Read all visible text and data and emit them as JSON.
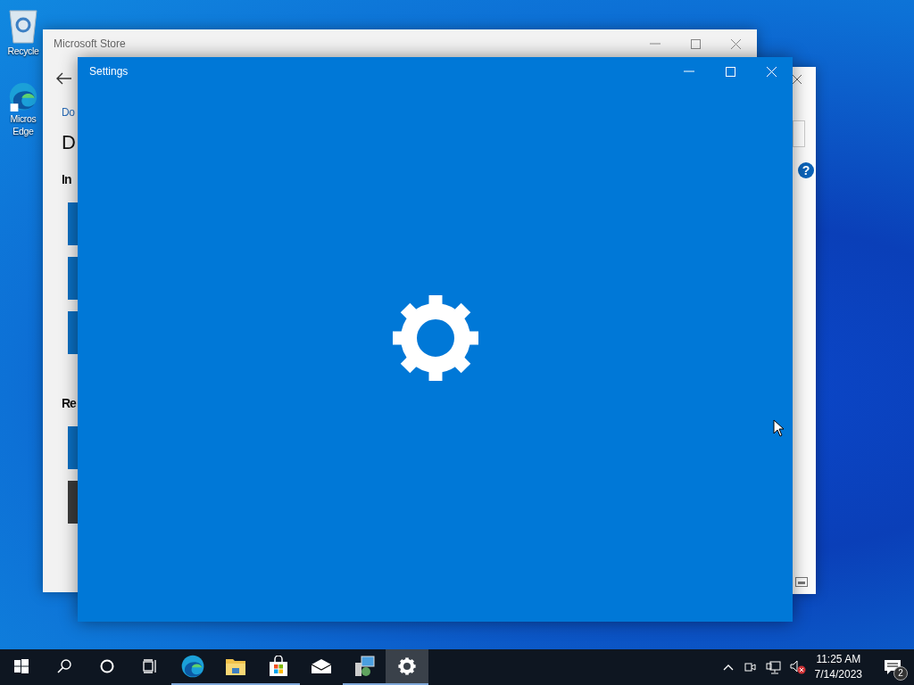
{
  "desktop_icons": [
    {
      "kind": "recycle-bin",
      "lines": [
        "Recycle"
      ]
    },
    {
      "kind": "edge",
      "lines": [
        "Micros",
        "Edge"
      ]
    }
  ],
  "store_window": {
    "title": "Microsoft Store",
    "breadcrumb": "Do",
    "heading": "D",
    "sections": [
      {
        "title": "In",
        "tiles": [
          {
            "color": "#0a6fc2"
          },
          {
            "color": "#0a6fc2"
          },
          {
            "color": "#0a6fc2"
          }
        ]
      },
      {
        "title": "Re",
        "tiles": [
          {
            "color": "#0a6fc2"
          },
          {
            "color": "#3b3b3b"
          }
        ]
      }
    ]
  },
  "back_window": {
    "help": "?"
  },
  "settings_window": {
    "title": "Settings"
  },
  "taskbar": {
    "items": [
      {
        "kind": "start",
        "running": false,
        "selected": false
      },
      {
        "kind": "search",
        "running": false,
        "selected": false
      },
      {
        "kind": "cortana",
        "running": false,
        "selected": false
      },
      {
        "kind": "task-view",
        "running": false,
        "selected": false
      },
      {
        "kind": "edge",
        "running": true,
        "selected": false
      },
      {
        "kind": "explorer",
        "running": true,
        "selected": false
      },
      {
        "kind": "store",
        "running": true,
        "selected": false
      },
      {
        "kind": "mail",
        "running": false,
        "selected": false
      },
      {
        "kind": "control-panel",
        "running": true,
        "selected": false
      },
      {
        "kind": "settings",
        "running": true,
        "selected": true
      }
    ],
    "tray": [
      {
        "kind": "chevron"
      },
      {
        "kind": "meet"
      },
      {
        "kind": "network"
      },
      {
        "kind": "volume-muted"
      }
    ],
    "time": "11:25 AM",
    "date": "7/14/2023",
    "notifications": "2"
  }
}
